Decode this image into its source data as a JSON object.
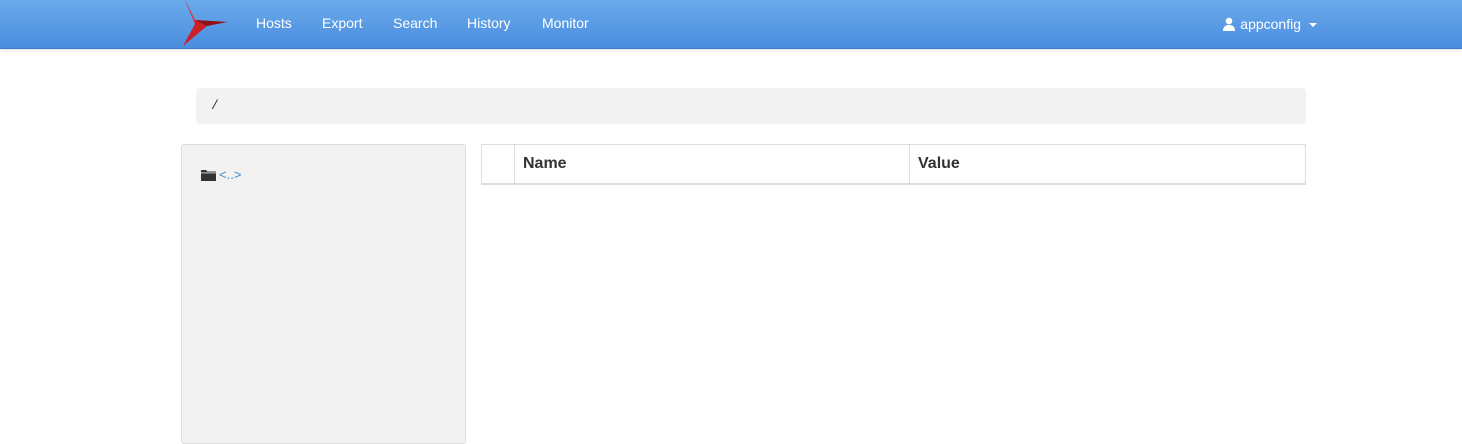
{
  "colors": {
    "navbar_top": "#6aaaea",
    "navbar_bottom": "#4a8de0",
    "logo_red": "#c9202a",
    "link": "#428bca",
    "panel_bg": "#f2f2f2"
  },
  "navbar": {
    "logo_icon": "bird-logo-icon",
    "items": [
      {
        "label": "Hosts"
      },
      {
        "label": "Export"
      },
      {
        "label": "Search"
      },
      {
        "label": "History"
      },
      {
        "label": "Monitor"
      }
    ],
    "user": {
      "icon": "user-icon",
      "label": "appconfig",
      "caret_icon": "caret-down-icon"
    }
  },
  "breadcrumb": {
    "path": "/"
  },
  "sidebar": {
    "entries": [
      {
        "icon": "folder-icon",
        "label": "<..>"
      }
    ]
  },
  "table": {
    "columns": [
      "",
      "Name",
      "Value"
    ],
    "rows": []
  }
}
